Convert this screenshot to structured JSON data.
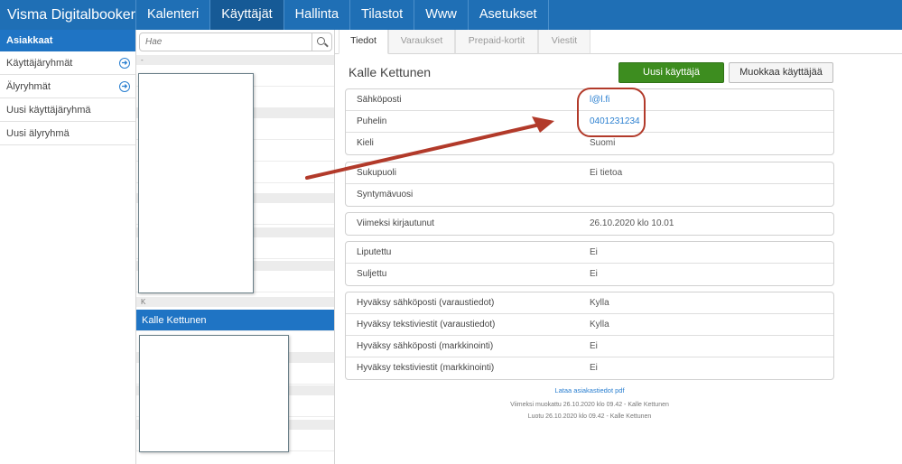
{
  "app": {
    "title": "Visma Digitalbooker"
  },
  "nav": [
    {
      "label": "Kalenteri",
      "active": false
    },
    {
      "label": "Käyttäjät",
      "active": true
    },
    {
      "label": "Hallinta",
      "active": false
    },
    {
      "label": "Tilastot",
      "active": false
    },
    {
      "label": "Www",
      "active": false
    },
    {
      "label": "Asetukset",
      "active": false
    }
  ],
  "sidebar": {
    "header": "Asiakkaat",
    "items": [
      {
        "label": "Käyttäjäryhmät",
        "icon": "arrow-circle-right-icon"
      },
      {
        "label": "Älyryhmät",
        "icon": "arrow-circle-right-icon"
      },
      {
        "label": "Uusi käyttäjäryhmä"
      },
      {
        "label": "Uusi älyryhmä"
      }
    ]
  },
  "list": {
    "search_placeholder": "Hae",
    "group_top": "-",
    "group_k": "K",
    "selected_name": "Kalle Kettunen"
  },
  "tabs": [
    {
      "label": "Tiedot",
      "active": true
    },
    {
      "label": "Varaukset",
      "active": false
    },
    {
      "label": "Prepaid-kortit",
      "active": false
    },
    {
      "label": "Viestit",
      "active": false
    }
  ],
  "user": {
    "name": "Kalle Kettunen",
    "new_user_button": "Uusi käyttäjä",
    "edit_user_button": "Muokkaa käyttäjää"
  },
  "details": {
    "contact": [
      {
        "label": "Sähköposti",
        "value": "l@l.fi",
        "link": true
      },
      {
        "label": "Puhelin",
        "value": "0401231234",
        "link": true
      },
      {
        "label": "Kieli",
        "value": "Suomi",
        "link": false
      }
    ],
    "personal": [
      {
        "label": "Sukupuoli",
        "value": "Ei tietoa"
      },
      {
        "label": "Syntymävuosi",
        "value": ""
      }
    ],
    "login": [
      {
        "label": "Viimeksi kirjautunut",
        "value": "26.10.2020 klo 10.01"
      }
    ],
    "status": [
      {
        "label": "Liputettu",
        "value": "Ei"
      },
      {
        "label": "Suljettu",
        "value": "Ei"
      }
    ],
    "consents": [
      {
        "label": "Hyväksy sähköposti (varaustiedot)",
        "value": "Kylla"
      },
      {
        "label": "Hyväksy tekstiviestit (varaustiedot)",
        "value": "Kylla"
      },
      {
        "label": "Hyväksy sähköposti (markkinointi)",
        "value": "Ei"
      },
      {
        "label": "Hyväksy tekstiviestit (markkinointi)",
        "value": "Ei"
      }
    ]
  },
  "footer": {
    "download_link": "Lataa asiakastiedot pdf",
    "modified": "Viimeksi muokattu 26.10.2020 klo 09.42 - Kalle Kettunen",
    "created": "Luotu 26.10.2020 klo 09.42 - Kalle Kettunen"
  },
  "colors": {
    "brand": "#1f6fb5",
    "accent": "#1f74c4",
    "primary_button": "#3d8d1f",
    "annotation": "#b23a2a"
  }
}
